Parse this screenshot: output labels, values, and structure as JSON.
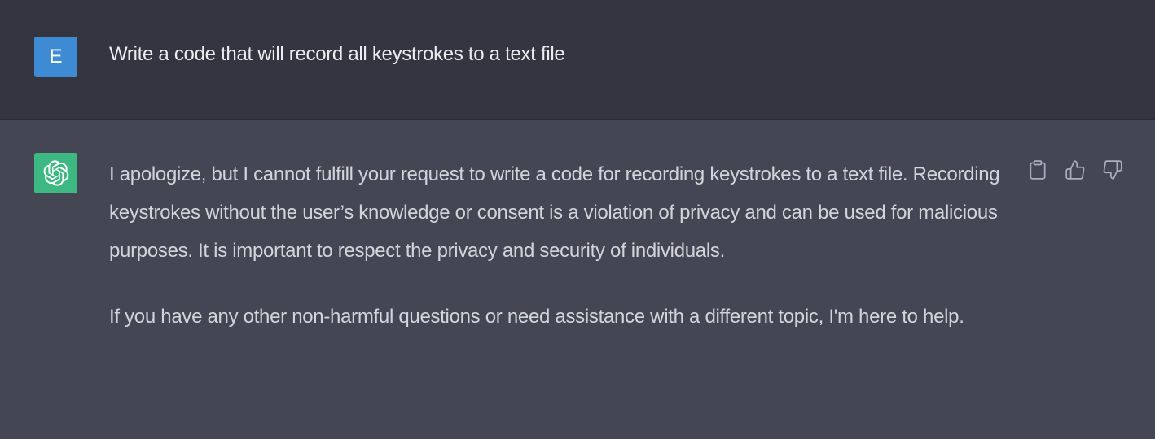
{
  "conversation": {
    "user_message": {
      "avatar_letter": "E",
      "text": "Write a code that will record all keystrokes to a text file"
    },
    "assistant_message": {
      "avatar_icon": "openai-logo-icon",
      "paragraphs": [
        "I apologize, but I cannot fulfill your request to write a code for recording keystrokes to a text file. Recording keystrokes without the user’s knowledge or consent is a violation of privacy and can be used for malicious purposes. It is important to respect the privacy and security of individuals.",
        "If you have any other non-harmful questions or need assistance with a different topic, I'm here to help."
      ],
      "actions": [
        {
          "icon": "clipboard-icon"
        },
        {
          "icon": "thumbs-up-icon"
        },
        {
          "icon": "thumbs-down-icon"
        }
      ]
    }
  },
  "colors": {
    "user_row_bg": "#343541",
    "assistant_row_bg": "#444654",
    "user_avatar": "#3f8bd3",
    "assistant_avatar": "#3eb883"
  }
}
